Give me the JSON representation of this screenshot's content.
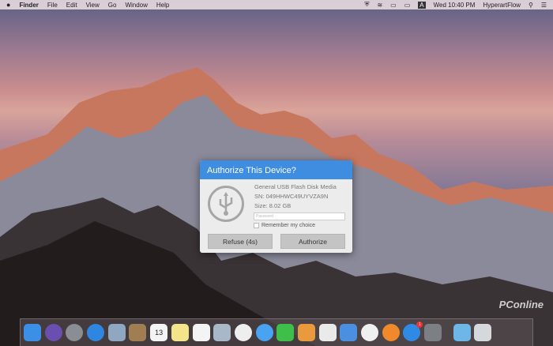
{
  "menubar": {
    "apple": "",
    "items": [
      "Finder",
      "File",
      "Edit",
      "View",
      "Go",
      "Window",
      "Help"
    ],
    "clock": "Wed 10:40 PM",
    "user": "HyperartFlow",
    "status_icons": [
      "shield-icon",
      "wifi-icon",
      "airplay-icon",
      "battery-icon",
      "input-source-icon"
    ]
  },
  "dialog": {
    "title": "Authorize This Device?",
    "device_name": "General USB Flash Disk Media",
    "serial": "SN: 049HHWC49UYVZA9N",
    "size": "Size: 8.02 GB",
    "password_placeholder": "Password",
    "remember_label": "Remember my choice",
    "refuse_label": "Refuse (4s)",
    "authorize_label": "Authorize",
    "accent": "#3f8de0"
  },
  "dock": {
    "apps": [
      {
        "name": "Finder",
        "color": "#3b8fe6"
      },
      {
        "name": "Siri",
        "color": "#6a4fb0"
      },
      {
        "name": "Launchpad",
        "color": "#8a8d93"
      },
      {
        "name": "Safari",
        "color": "#2f86e0"
      },
      {
        "name": "Preview",
        "color": "#8fa7c0"
      },
      {
        "name": "Contacts",
        "color": "#a07e52"
      },
      {
        "name": "Calendar",
        "color": "#f4f4f4",
        "text": "13"
      },
      {
        "name": "Notes",
        "color": "#f4e58a"
      },
      {
        "name": "Reminders",
        "color": "#f4f4f4"
      },
      {
        "name": "Image Capture",
        "color": "#a8b8c8"
      },
      {
        "name": "Photos",
        "color": "#eeeeee"
      },
      {
        "name": "Messages",
        "color": "#4aa3f0"
      },
      {
        "name": "FaceTime",
        "color": "#3fbf4a"
      },
      {
        "name": "Pages",
        "color": "#e89a3c"
      },
      {
        "name": "Numbers",
        "color": "#eaeaea"
      },
      {
        "name": "Keynote",
        "color": "#4b8fe0"
      },
      {
        "name": "iTunes",
        "color": "#f0f0f0"
      },
      {
        "name": "iBooks",
        "color": "#f0892b"
      },
      {
        "name": "App Store",
        "color": "#2f8ae6",
        "badge": "1"
      },
      {
        "name": "System Preferences",
        "color": "#7c7f84"
      },
      {
        "name": "Downloads",
        "color": "#6fb6e8"
      },
      {
        "name": "Trash",
        "color": "#d6d9dc"
      }
    ]
  },
  "watermark": "PConline"
}
